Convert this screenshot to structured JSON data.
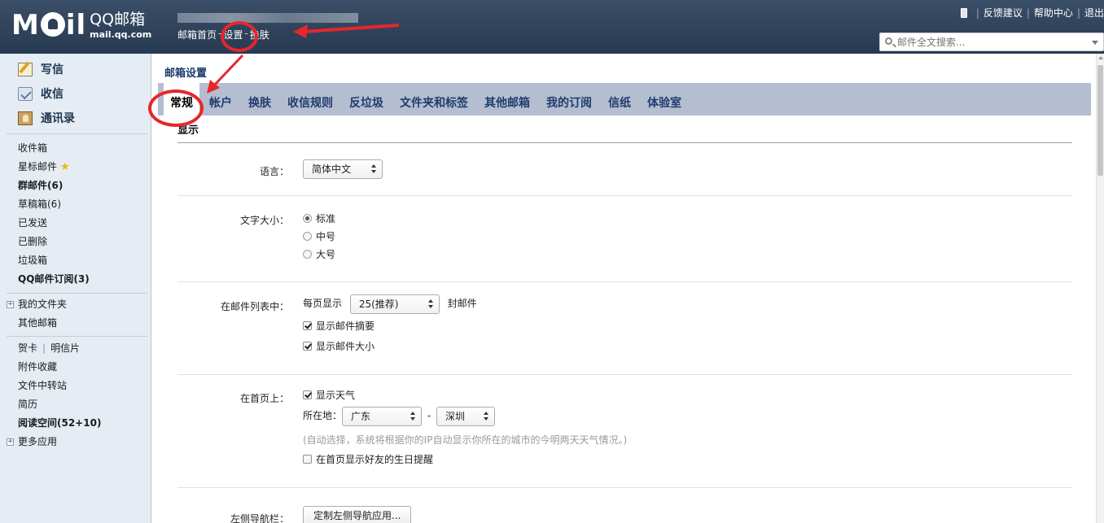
{
  "header": {
    "logo_mark": "M",
    "logo_mark_tail": "il",
    "logo_brand": "QQ邮箱",
    "logo_domain": "mail.qq.com",
    "nav": [
      "邮箱首页",
      "设置",
      "换肤"
    ],
    "nav_sep": "-",
    "links": [
      "反馈建议",
      "帮助中心",
      "退出"
    ],
    "link_sep": "|",
    "search_placeholder": "邮件全文搜索..."
  },
  "sidebar": {
    "primary": [
      {
        "label": "写信",
        "icon": "compose-icon"
      },
      {
        "label": "收信",
        "icon": "inbox-icon"
      },
      {
        "label": "通讯录",
        "icon": "contacts-icon"
      }
    ],
    "folders": [
      "收件箱",
      "星标邮件",
      "群邮件(6)",
      "草稿箱(6)",
      "已发送",
      "已删除",
      "垃圾箱",
      "QQ邮件订阅(3)"
    ],
    "my_folders": "我的文件夹",
    "other_mail": "其他邮箱",
    "card": "贺卡",
    "postcard": "明信片",
    "apps": [
      "附件收藏",
      "文件中转站",
      "简历",
      "阅读空间(52+10)"
    ],
    "more_apps": "更多应用"
  },
  "main": {
    "page_title": "邮箱设置",
    "tabs": [
      "常规",
      "帐户",
      "换肤",
      "收信规则",
      "反垃圾",
      "文件夹和标签",
      "其他邮箱",
      "我的订阅",
      "信纸",
      "体验室"
    ],
    "active_tab": "常规",
    "section_title": "显示",
    "language": {
      "label": "语言：",
      "value": "简体中文"
    },
    "font_size": {
      "label": "文字大小：",
      "options": [
        "标准",
        "中号",
        "大号"
      ],
      "selected": "标准"
    },
    "mail_list": {
      "label": "在邮件列表中：",
      "per_page_prefix": "每页显示",
      "per_page_value": "25(推荐)",
      "per_page_suffix": "封邮件",
      "show_summary": "显示邮件摘要",
      "show_size": "显示邮件大小"
    },
    "home": {
      "label": "在首页上：",
      "show_weather": "显示天气",
      "location_label": "所在地：",
      "province": "广东",
      "dash": "-",
      "city": "深圳",
      "hint": "(自动选择，系统将根据你的IP自动显示你所在的城市的今明两天天气情况。)",
      "birthday": "在首页显示好友的生日提醒"
    },
    "left_nav": {
      "label": "左侧导航栏：",
      "button": "定制左侧导航应用..."
    }
  },
  "colors": {
    "annotation": "#e8262b",
    "header_bg": "#2f435c",
    "sidebar_bg": "#e5ecf3",
    "tab_bar": "#b4bed0"
  }
}
